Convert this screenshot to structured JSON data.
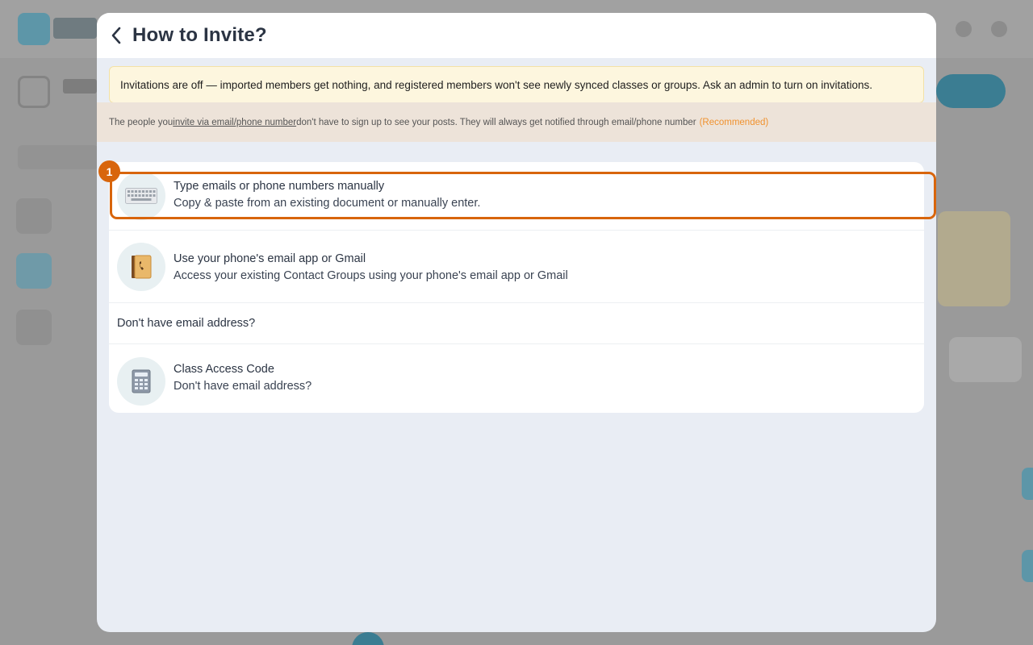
{
  "modal": {
    "title": "How to Invite?",
    "warning": "Invitations are off — imported members get nothing, and registered members won't see newly synced classes or groups. Ask an admin to turn on invitations.",
    "info": {
      "before": "The people you ",
      "link": "invite via email/phone number ",
      "after": "don't have to sign up to see your posts. They will always get notified through email/phone number",
      "recommended": "(Recommended)"
    },
    "options": [
      {
        "title": "Type emails or phone numbers manually",
        "subtitle": "Copy & paste from an existing document or manually enter.",
        "icon": "keyboard-icon"
      },
      {
        "title": "Use your phone's email app or Gmail",
        "subtitle": "Access your existing Contact Groups using your phone's email app or Gmail",
        "icon": "address-book-icon"
      }
    ],
    "no_email_label": "Don't have email address?",
    "class_code": {
      "title": "Class Access Code",
      "subtitle": "Don't have email address?",
      "icon": "calculator-icon"
    }
  },
  "annotation": {
    "step": "1"
  },
  "colors": {
    "accent": "#d8650c",
    "recommended": "#f0922f",
    "warning_bg": "#fdf6de",
    "info_bg": "#ede3d9"
  }
}
